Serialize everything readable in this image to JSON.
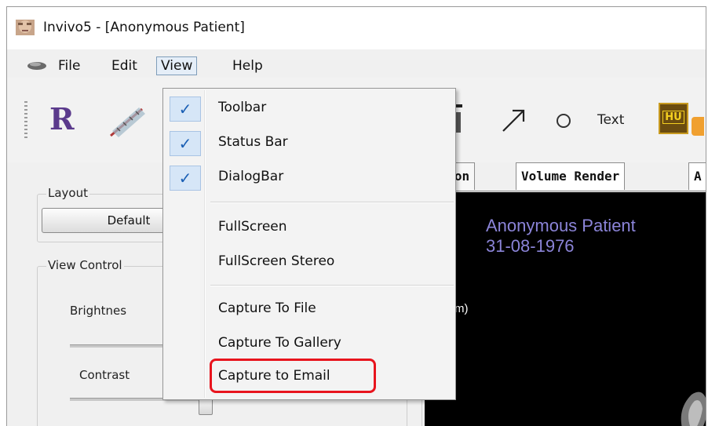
{
  "window": {
    "title": "Invivo5 - [Anonymous Patient]"
  },
  "menubar": {
    "items": [
      {
        "label": "File"
      },
      {
        "label": "Edit"
      },
      {
        "label": "View"
      },
      {
        "label": "Help"
      }
    ]
  },
  "view_menu": {
    "items": [
      {
        "label": "Toolbar",
        "checked": true
      },
      {
        "label": "Status Bar",
        "checked": true
      },
      {
        "label": "DialogBar",
        "checked": true
      },
      {
        "label": "FullScreen",
        "checked": false
      },
      {
        "label": "FullScreen Stereo",
        "checked": false
      },
      {
        "label": "Capture To File",
        "checked": false
      },
      {
        "label": "Capture To Gallery",
        "checked": false
      },
      {
        "label": "Capture to Email",
        "checked": false,
        "highlighted": true
      }
    ],
    "check_glyph": "✓"
  },
  "toolbar": {
    "r_label": "R",
    "text_tool_label": "Text",
    "hu_label": "HU"
  },
  "left_panel": {
    "layout_group_label": "Layout",
    "layout_button_label": "Default",
    "view_control_label": "View Control",
    "brightness_label": "Brightnes",
    "contrast_label": "Contrast"
  },
  "tabs": [
    {
      "label": "ction"
    },
    {
      "label": "Volume Render"
    },
    {
      "label": "A"
    }
  ],
  "viewport": {
    "patient_name": "Anonymous Patient",
    "patient_dob": "31-08-1976",
    "fragment_text": "m)"
  },
  "colors": {
    "highlight_border": "#e8141d",
    "patient_text": "#8b84d8",
    "check_color": "#1a5fb4"
  }
}
